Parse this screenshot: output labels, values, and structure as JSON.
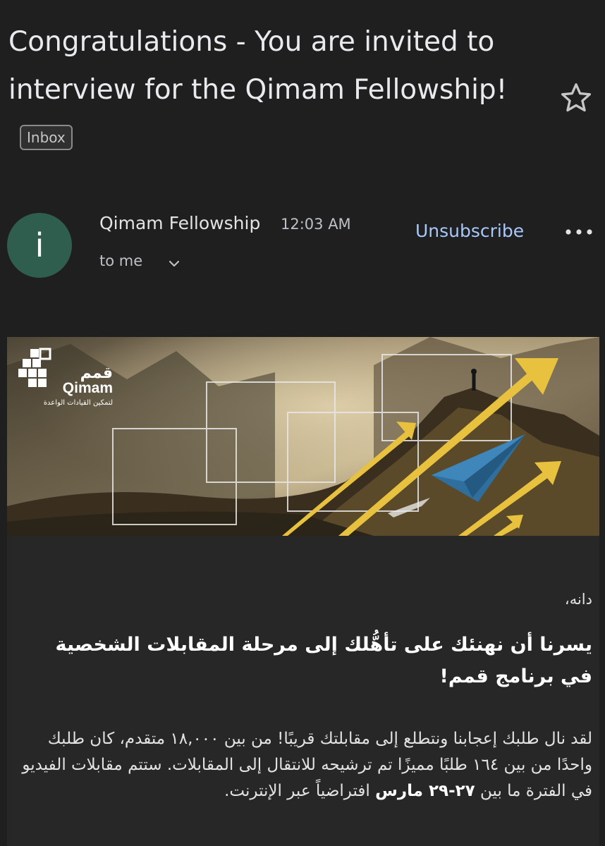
{
  "email": {
    "subject": "Congratulations - You are invited to interview for the Qimam Fellowship!",
    "label_badge": "Inbox",
    "sender": {
      "avatar_letter": "i",
      "avatar_color": "#2f5e4e",
      "name": "Qimam Fellowship",
      "time": "12:03 AM",
      "recipient": "to me"
    },
    "unsubscribe_label": "Unsubscribe"
  },
  "banner": {
    "logo_arabic": "قمم",
    "logo_latin": "Qimam",
    "logo_tagline": "لتمكين القيادات الواعدة"
  },
  "body": {
    "greeting": "دانه،",
    "headline": "يسرنا أن نهنئك على تأهُّلك إلى مرحلة المقابلات الشخصية في برنامج قمم!",
    "paragraph_part1": "لقد نال طلبك إعجابنا ونتطلع إلى مقابلتك قريبًا! من بين ١٨,٠٠٠ متقدم، كان طلبك واحدًا من بين ١٦٤ طلبًا مميزًا تم ترشيحه للانتقال إلى المقابلات. ستتم مقابلات الفيديو في الفترة ما بين ",
    "paragraph_bold": "٢٧-٢٩ مارس",
    "paragraph_part2": " افتراضياً عبر الإنترنت."
  },
  "icons": {
    "star": "star-icon",
    "more": "more-horizontal-icon",
    "chevron": "chevron-down-icon"
  },
  "colors": {
    "background": "#1f1f1f",
    "link": "#a8c7fa",
    "arrow_gold": "#e8c23f",
    "plane_blue": "#2f6f9e"
  }
}
